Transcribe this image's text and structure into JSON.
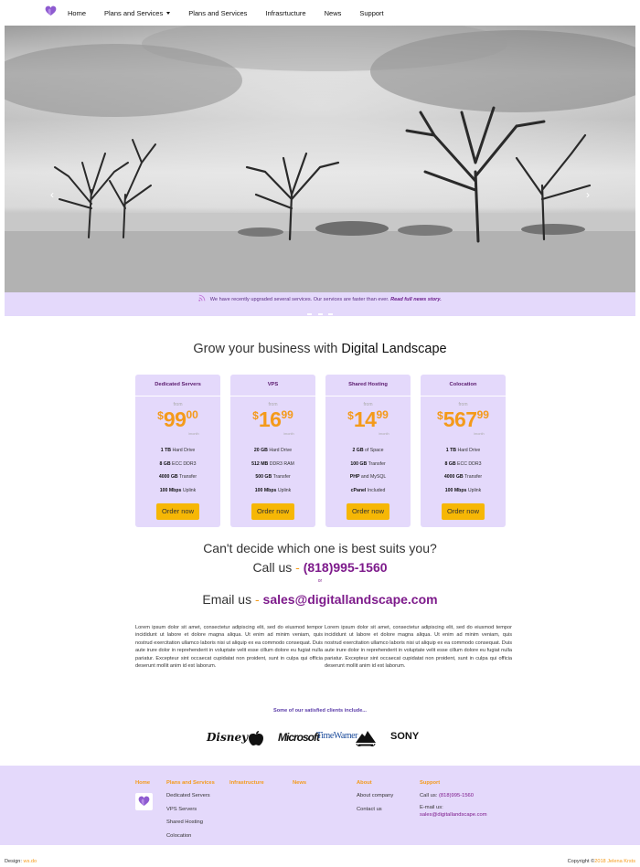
{
  "nav": {
    "items": [
      {
        "label": "Home",
        "dropdown": false
      },
      {
        "label": "Plans and Services",
        "dropdown": true
      },
      {
        "label": "Plans and Services",
        "dropdown": false
      },
      {
        "label": "Infrasrtucture",
        "dropdown": false
      },
      {
        "label": "News",
        "dropdown": false
      },
      {
        "label": "Support",
        "dropdown": false
      }
    ]
  },
  "hero": {
    "prev_icon": "chevron-left-icon",
    "next_icon": "chevron-right-icon"
  },
  "news": {
    "text": "We have recently upgraded several services. Our services are faster than ever.",
    "link": "Read full news story."
  },
  "headline": {
    "prefix": "Grow your business with",
    "brand": "Digital Landscape"
  },
  "plans": [
    {
      "title": "Dedicated Servers",
      "from": "from",
      "currency": "$",
      "int": "99",
      "cents": "00",
      "per": "/month",
      "features": [
        [
          "1 TB",
          "Hard Drive"
        ],
        [
          "8 GB",
          "ECC DDR3"
        ],
        [
          "4000 GB",
          "Transfer"
        ],
        [
          "100 Mbps",
          "Uplink"
        ]
      ],
      "button": "Order now"
    },
    {
      "title": "VPS",
      "from": "from",
      "currency": "$",
      "int": "16",
      "cents": "99",
      "per": "/month",
      "features": [
        [
          "20 GB",
          "Hard Drive"
        ],
        [
          "512 MB",
          "DDR3 RAM"
        ],
        [
          "500 GB",
          "Transfer"
        ],
        [
          "100 Mbps",
          "Uplink"
        ]
      ],
      "button": "Order now"
    },
    {
      "title": "Shared Hosting",
      "from": "from",
      "currency": "$",
      "int": "14",
      "cents": "99",
      "per": "/month",
      "features": [
        [
          "2 GB",
          "of Space"
        ],
        [
          "100 GB",
          "Transfer"
        ],
        [
          "PHP",
          "and MySQL"
        ],
        [
          "cPanel",
          "Included"
        ]
      ],
      "button": "Order now"
    },
    {
      "title": "Colocation",
      "from": "from",
      "currency": "$",
      "int": "567",
      "cents": "99",
      "per": "/month",
      "features": [
        [
          "1 TB",
          "Hard Drive"
        ],
        [
          "8 GB",
          "ECC DDR3"
        ],
        [
          "4000 GB",
          "Transfer"
        ],
        [
          "100 Mbps",
          "Uplink"
        ]
      ],
      "button": "Order now"
    }
  ],
  "contact": {
    "question": "Can't decide which one is best suits you?",
    "call_label": "Call us",
    "dash": "-",
    "phone": "(818)995-1560",
    "or": "or",
    "email_label": "Email us",
    "email": "sales@digitallandscape.com"
  },
  "lorem": [
    "Lorem ipsum dolor sit amet, consectetur adipiscing elit, sed do eiusmod tempor incididunt ut labore et dolore magna aliqua. Ut enim ad minim veniam, quis nostrud exercitation ullamco laboris nisi ut aliquip ex ea commodo consequat. Duis aute irure dolor in reprehenderit in voluptate velit esse cillum dolore eu fugiat nulla pariatur. Excepteur sint occaecat cupidatat non proident, sunt in culpa qui officia deserunt mollit anim id est laborum.",
    "Lorem ipsum dolor sit amet, consectetur adipiscing elit, sed do eiusmod tempor incididunt ut labore et dolore magna aliqua. Ut enim ad minim veniam, quis nostrud exercitation ullamco laboris nisi ut aliquip ex ea commodo consequat. Duis aute irure dolor in reprehenderit in voluptate velit esse cillum dolore eu fugiat nulla pariatur. Excepteur sint occaecat cupidatat non proident, sunt in culpa qui officia deserunt mollit anim id est laborum."
  ],
  "clients": {
    "title": "Some of our satisfied clients include...",
    "logos": [
      "Disney",
      "Apple",
      "Microsoft",
      "TimeWarner",
      "Paramount",
      "SONY"
    ]
  },
  "footer": {
    "home": "Home",
    "plans_head": "Plans and Services",
    "plans_links": [
      "Dedicated Servers",
      "VPS Servers",
      "Shared Hosting",
      "Colocation"
    ],
    "infra_head": "Infrastructure",
    "news_head": "News",
    "about_head": "About",
    "about_links": [
      "About company",
      "Contact us"
    ],
    "support_head": "Support",
    "support_call": "Call us:",
    "support_phone": "(818)995-1560",
    "support_email_label": "E-mail us:",
    "support_email": "sales@digitallandscape.com"
  },
  "bottom": {
    "design_label": "Design:",
    "design_link": "ws.do",
    "copyright_prefix": "Copyright ©",
    "copyright_link": "2018 Jelena Krsts"
  },
  "colors": {
    "accent_purple": "#7d1a8b",
    "lavender": "#e4d9fb",
    "orange": "#f49a1a",
    "button_yellow": "#f6b705"
  }
}
